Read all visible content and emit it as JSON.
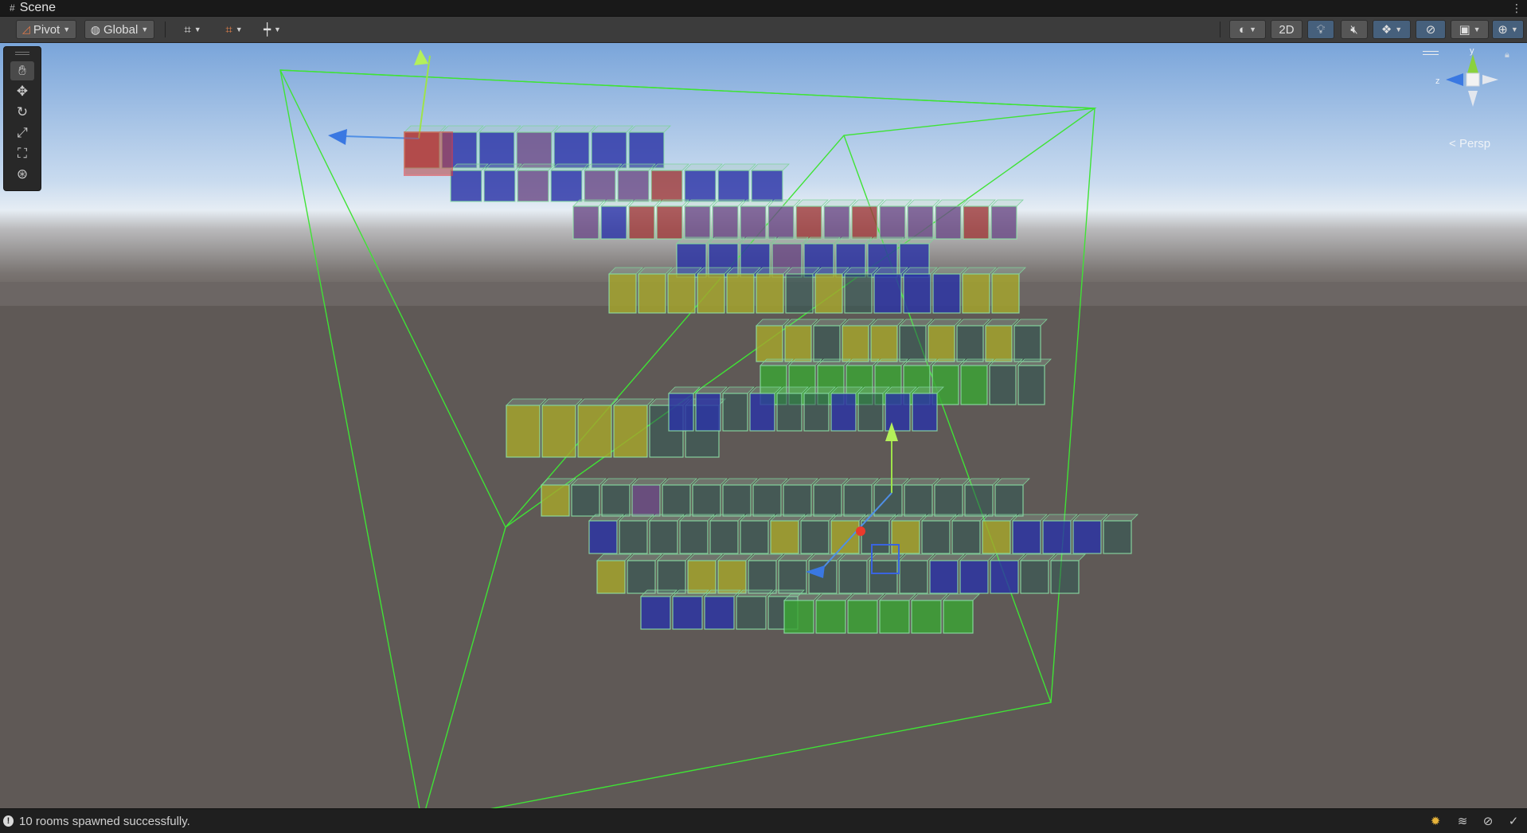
{
  "tab": {
    "title": "Scene",
    "icon": "grid-icon",
    "menu_icon": "kebab-menu-icon"
  },
  "toolbar": {
    "pivot_label": "Pivot",
    "global_label": "Global",
    "mode_2d_label": "2D",
    "icons": [
      "grid-snap-icon",
      "increment-snap-icon",
      "ruler-icon",
      "shading-mode-icon",
      "lighting-icon",
      "audio-mute-icon",
      "effects-icon",
      "hidden-objects-icon",
      "camera-icon",
      "gizmos-icon"
    ]
  },
  "tools": [
    "hand-tool-icon",
    "move-tool-icon",
    "rotate-tool-icon",
    "scale-tool-icon",
    "rect-tool-icon",
    "transform-tool-icon"
  ],
  "gizmo": {
    "y_label": "y",
    "z_label": "z",
    "projection_label": "Persp"
  },
  "scene": {
    "colors": {
      "sky_top": "#7fa9dc",
      "horizon": "#dce7f2",
      "ground": "#5d5855",
      "bounds": "#39e031",
      "red": "#9e3a3a",
      "blue": "#2b33a6",
      "purple": "#6b4c86",
      "yellow": "#a6a62c",
      "green": "#3aa534",
      "teal": "#2f5a55"
    }
  },
  "status": {
    "message": "10 rooms spawned successfully.",
    "icons": [
      "debug-icon",
      "layers-icon",
      "visibility-icon",
      "check-icon"
    ]
  }
}
